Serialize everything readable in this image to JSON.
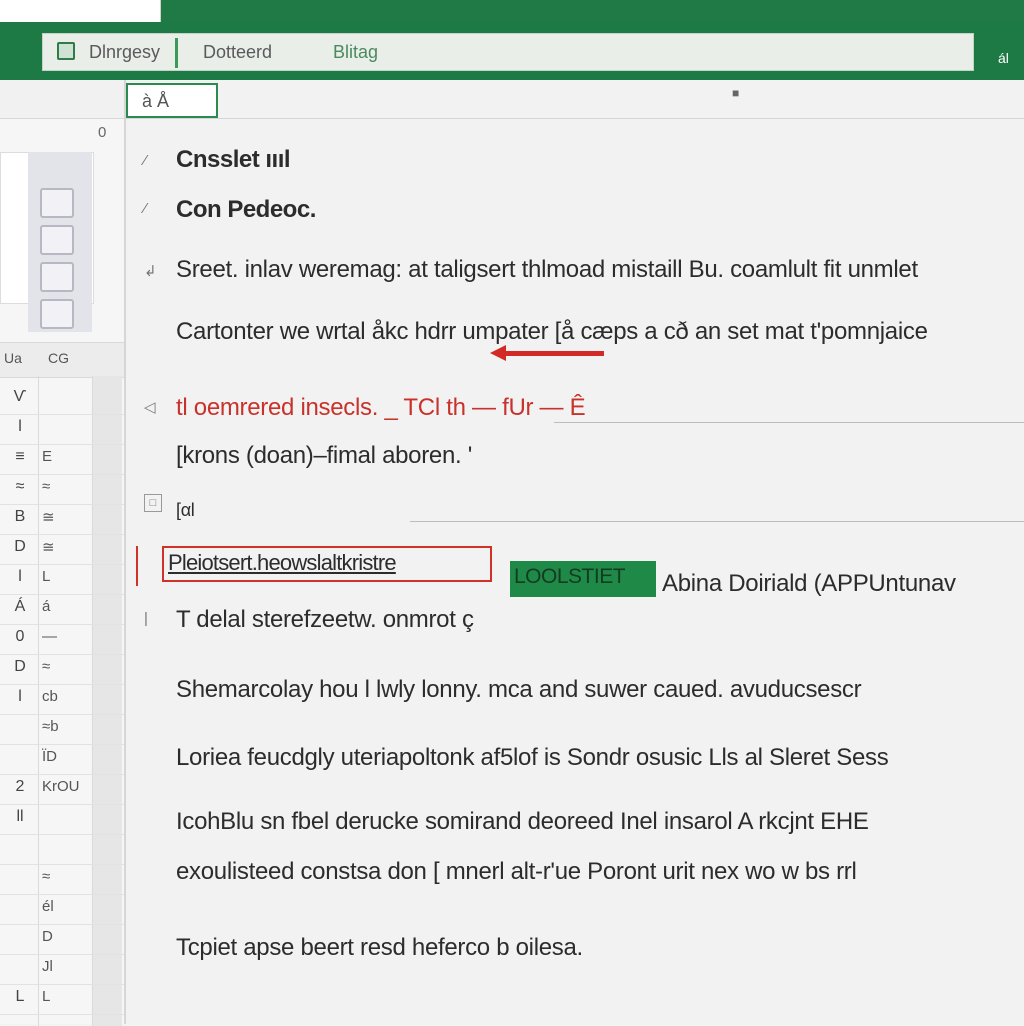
{
  "window": {
    "tabs": [
      {
        "label": "Dlnrgesy"
      },
      {
        "label": "Dotteerd"
      },
      {
        "label": "Blitag"
      }
    ],
    "right_mark": "ál"
  },
  "left_panel": {
    "col_header_top": "0",
    "band_left": "Ua",
    "band_right": "CG",
    "rows": [
      {
        "label": "Ѵ",
        "cell": ""
      },
      {
        "label": "l",
        "cell": ""
      },
      {
        "label": "≡",
        "cell": "E"
      },
      {
        "label": "≈",
        "cell": "≈"
      },
      {
        "label": "B",
        "cell": "≅"
      },
      {
        "label": "D",
        "cell": "≅"
      },
      {
        "label": "l",
        "cell": "L"
      },
      {
        "label": "Á",
        "cell": "á"
      },
      {
        "label": "0",
        "cell": "—"
      },
      {
        "label": "D",
        "cell": "≈"
      },
      {
        "label": "l",
        "cell": "cb"
      },
      {
        "label": "",
        "cell": "≈b"
      },
      {
        "label": "",
        "cell": "ЇD"
      },
      {
        "label": "2",
        "cell": "KrOU"
      },
      {
        "label": "ll",
        "cell": ""
      },
      {
        "label": "",
        "cell": ""
      },
      {
        "label": "",
        "cell": "≈"
      },
      {
        "label": "",
        "cell": "él"
      },
      {
        "label": "",
        "cell": "D"
      },
      {
        "label": "",
        "cell": "Jl"
      },
      {
        "label": "L",
        "cell": "L"
      }
    ]
  },
  "document": {
    "cell_ref": "à Å",
    "heading1": "Cnsslet ıııl",
    "heading2": "Con Pedeoc.",
    "lines": [
      "Sreet. inlav weremag: at taligsert thlmoad mistaill Bu. coamlult fit unmlet",
      "Cartonter we wrtal åkc hdrr umpater  [å cæps a cð  an set mat t'pomnjaice",
      "tl oemrered insecls. _ TCl th — fUr — Ê",
      "[krons (doan)–fimal aboren. '",
      "[αl",
      "T delal sterefzeetw. onmrot ç",
      "Shemarcolay hou l lwly lonny. mca and suwer caued.  avuducsescr",
      "Loriea feucdgly uteriapoltonk af5lof is Sondr osusic Lls al Sleret Sess",
      "IcohBlu sn fbel derucke somirand deoreed Inel insarol A rkcjnt EHE",
      "exoulisteed constsa don [ mnerl alt-r'ue Poront urit nex wo w bs rrl",
      "Tcpiet apse beert resd heferco b oilesa."
    ],
    "boxed_text": "Pleiotsert.heowslaltkristre",
    "green_button": "LOOLSTIET",
    "after_button": "Abina Doiriald  (APPUntunav"
  }
}
